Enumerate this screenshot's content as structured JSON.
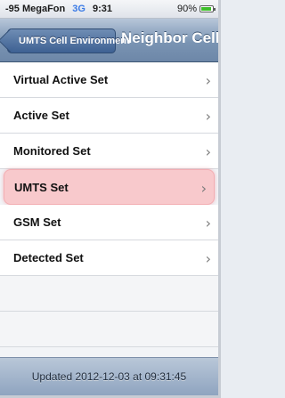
{
  "status_bar": {
    "carrier": "-95 MegaFon",
    "network": "3G",
    "time": "9:31",
    "battery_percent": "90%"
  },
  "nav": {
    "back_label": "UMTS Cell Environment",
    "title": "Neighbor Cells"
  },
  "list": {
    "items": [
      {
        "label": "Virtual Active Set"
      },
      {
        "label": "Active Set"
      },
      {
        "label": "Monitored Set"
      },
      {
        "label": "UMTS Set"
      },
      {
        "label": "GSM Set"
      },
      {
        "label": "Detected Set"
      }
    ],
    "chevron": "›"
  },
  "footer": {
    "updated": "Updated 2012-12-03 at 09:31:45"
  },
  "colors": {
    "highlight": "#f8c9cc",
    "network_mode": "#3b7be6",
    "battery": "#3fbf2c"
  }
}
